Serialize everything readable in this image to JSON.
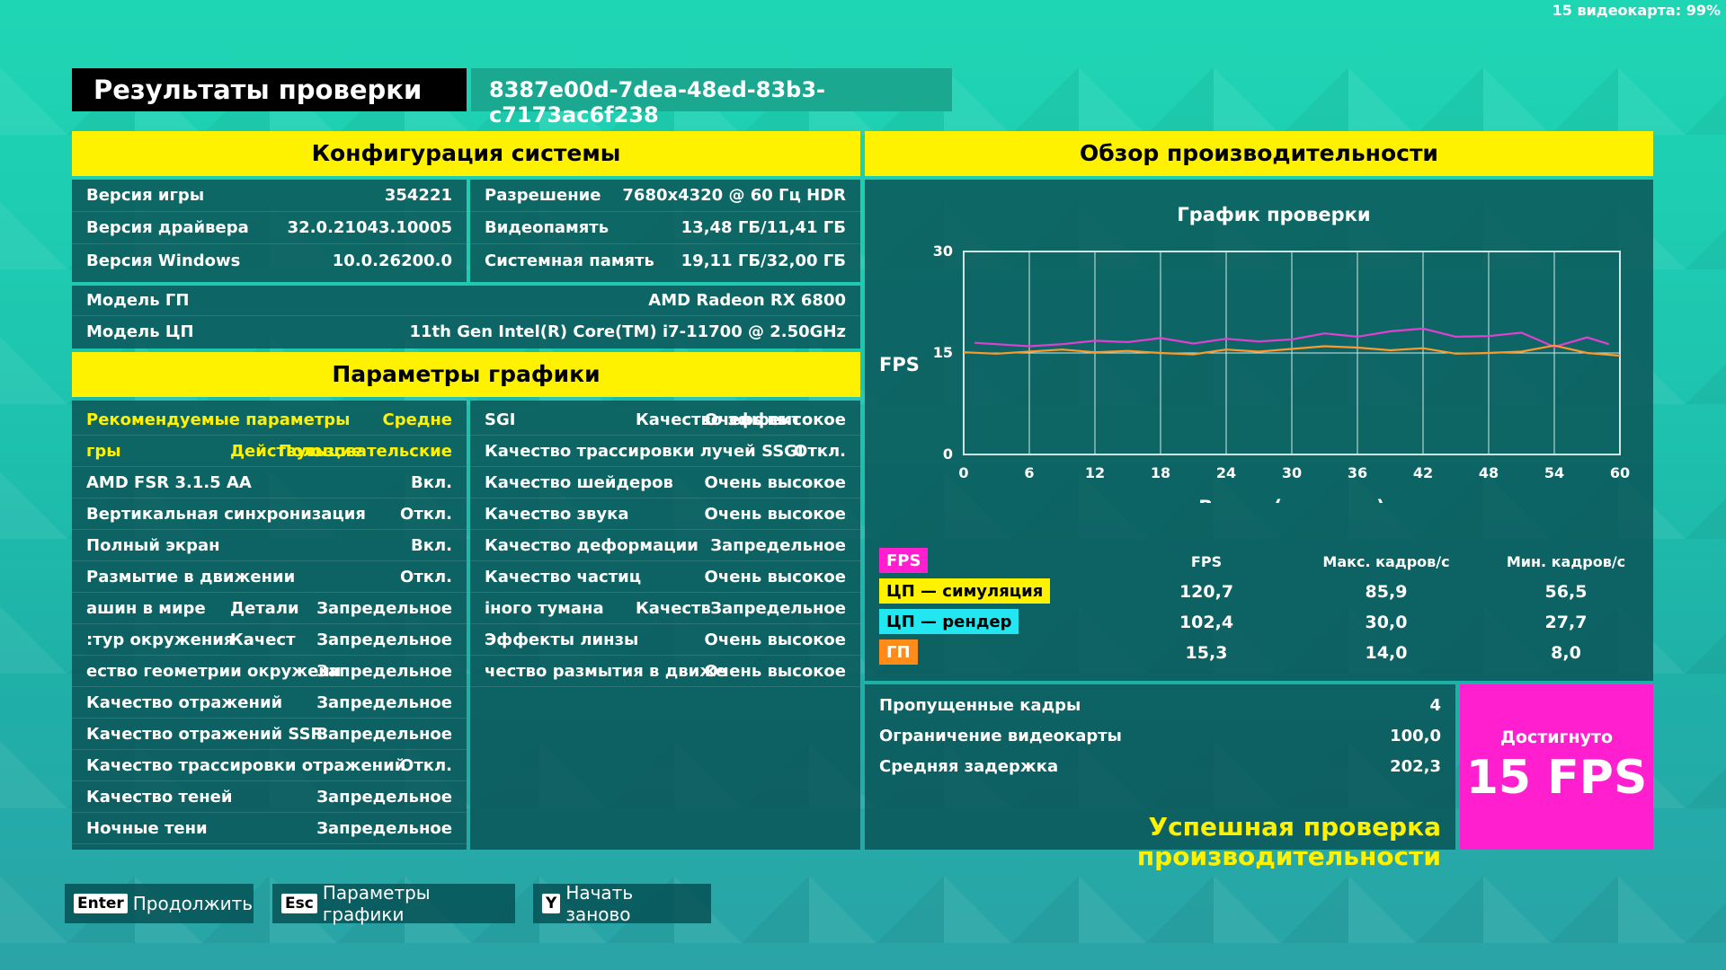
{
  "overlay": "15 видеокарта: 99%",
  "header": {
    "title": "Результаты проверки",
    "uuid": "8387e00d-7dea-48ed-83b3-c7173ac6f238"
  },
  "system": {
    "title": "Конфигурация системы",
    "left": [
      {
        "label": "Версия игры",
        "value": "354221"
      },
      {
        "label": "Версия драйвера",
        "value": "32.0.21043.10005"
      },
      {
        "label": "Версия Windows",
        "value": "10.0.26200.0"
      }
    ],
    "right": [
      {
        "label": "Разрешение",
        "value": "7680x4320 @ 60 Гц HDR"
      },
      {
        "label": "Видеопамять",
        "value": "13,48 ГБ/11,41 ГБ"
      },
      {
        "label": "Системная память",
        "value": "19,11 ГБ/32,00 ГБ"
      }
    ],
    "full": [
      {
        "label": "Модель ГП",
        "value": "AMD Radeon RX 6800"
      },
      {
        "label": "Модель ЦП",
        "value": "11th Gen Intel(R) Core(TM) i7-11700 @ 2.50GHz"
      }
    ]
  },
  "graphics": {
    "title": "Параметры графики",
    "left": [
      {
        "a": "Рекомендуемые параметры",
        "c": "Средне"
      },
      {
        "a": "гры",
        "b": "Действующие",
        "c": "Пользовательские"
      },
      {
        "a": "AMD FSR 3.1.5 AA",
        "c": "Вкл."
      },
      {
        "a": "Вертикальная синхронизация",
        "c": "Откл."
      },
      {
        "a": "Полный экран",
        "c": "Вкл."
      },
      {
        "a": "Размытие в движении",
        "c": "Откл."
      },
      {
        "a": "ашин в мире",
        "b": "Детали",
        "c": "Запредельное"
      },
      {
        "a": ":тур окружения",
        "b": "Качест",
        "c": "Запредельное"
      },
      {
        "a": "ество геометрии окружени",
        "c": "Запредельное"
      },
      {
        "a": "Качество отражений",
        "c": "Запредельное"
      },
      {
        "a": "Качество отражений SSR",
        "c": "Запредельное"
      },
      {
        "a": "Качество трассировки отражений",
        "c": "Откл."
      },
      {
        "a": "Качество теней",
        "c": "Запредельное"
      },
      {
        "a": "Ночные тени",
        "c": "Запредельное"
      }
    ],
    "right": [
      {
        "a": "SGI",
        "b": "Качество эффект",
        "c": "Очень высокое"
      },
      {
        "a": "Качество трассировки лучей SSGI",
        "c": "Откл."
      },
      {
        "a": "Качество шейдеров",
        "c": "Очень высокое"
      },
      {
        "a": "Качество звука",
        "c": "Очень высокое"
      },
      {
        "a": "Качество деформации",
        "c": "Запредельное"
      },
      {
        "a": "Качество частиц",
        "c": "Очень высокое"
      },
      {
        "a": "іного тумана",
        "b": "Качеств",
        "c": "Запредельное"
      },
      {
        "a": "Эффекты линзы",
        "c": "Очень высокое"
      },
      {
        "a": "чество размытия в движе",
        "c": "Очень высокое"
      }
    ]
  },
  "performance": {
    "title": "Обзор производительности",
    "chart_title": "График проверки",
    "ylabel": "FPS",
    "xlabel": "Время (секунды)",
    "table_headers": [
      "FPS",
      "Макс. кадров/с",
      "Мин. кадров/с"
    ],
    "legend": [
      {
        "label": "FPS",
        "color": "#ff1fcf",
        "text_color": "#ffffff"
      },
      {
        "label": "ЦП — симуляция",
        "color": "#fff200",
        "text_color": "#000000"
      },
      {
        "label": "ЦП — рендер",
        "color": "#22e6f0",
        "text_color": "#000000"
      },
      {
        "label": "ГП",
        "color": "#ff8c1a",
        "text_color": "#ffffff"
      }
    ],
    "rows": [
      [
        "120,7",
        "85,9",
        "56,5"
      ],
      [
        "102,4",
        "30,0",
        "27,7"
      ],
      [
        "15,3",
        "14,0",
        "8,0"
      ]
    ]
  },
  "summary": {
    "items": [
      {
        "label": "Пропущенные кадры",
        "value": "4"
      },
      {
        "label": "Ограничение видеокарты",
        "value": "100,0"
      },
      {
        "label": "Средняя задержка",
        "value": "202,3"
      }
    ],
    "success": "Успешная проверка производительности",
    "achieved_label": "Достигнуто",
    "achieved_value": "15 FPS"
  },
  "footer": [
    {
      "key": "Enter",
      "label": "Продолжить"
    },
    {
      "key": "Esc",
      "label": "Параметры графики"
    },
    {
      "key": "Y",
      "label": "Начать заново"
    }
  ],
  "chart_data": {
    "type": "line",
    "xlim": [
      0,
      60
    ],
    "ylim": [
      0,
      30
    ],
    "xticks": [
      0,
      6,
      12,
      18,
      24,
      30,
      36,
      42,
      48,
      54,
      60
    ],
    "yticks": [
      0,
      15,
      30
    ],
    "xlabel": "Время (секунды)",
    "ylabel": "FPS",
    "title": "График проверки",
    "grid": true,
    "series": [
      {
        "name": "FPS",
        "color": "#e040d0",
        "x": [
          1,
          3,
          6,
          9,
          12,
          15,
          18,
          21,
          24,
          27,
          30,
          33,
          36,
          39,
          42,
          45,
          48,
          51,
          54,
          57,
          59
        ],
        "y": [
          16.5,
          16.3,
          16.0,
          16.3,
          16.8,
          16.6,
          17.2,
          16.4,
          17.1,
          16.7,
          17.0,
          17.9,
          17.4,
          18.2,
          18.6,
          17.4,
          17.5,
          18.0,
          15.9,
          17.3,
          16.3
        ]
      },
      {
        "name": "ГП",
        "color": "#ff9a2a",
        "x": [
          0,
          3,
          6,
          9,
          12,
          15,
          18,
          21,
          24,
          27,
          30,
          33,
          36,
          39,
          42,
          45,
          48,
          51,
          54,
          57,
          60
        ],
        "y": [
          15.1,
          14.9,
          15.2,
          15.5,
          15.1,
          15.3,
          15.0,
          14.8,
          15.5,
          15.2,
          15.6,
          16.0,
          15.8,
          15.4,
          15.7,
          14.9,
          15.0,
          15.2,
          16.1,
          15.0,
          14.6
        ]
      }
    ]
  }
}
